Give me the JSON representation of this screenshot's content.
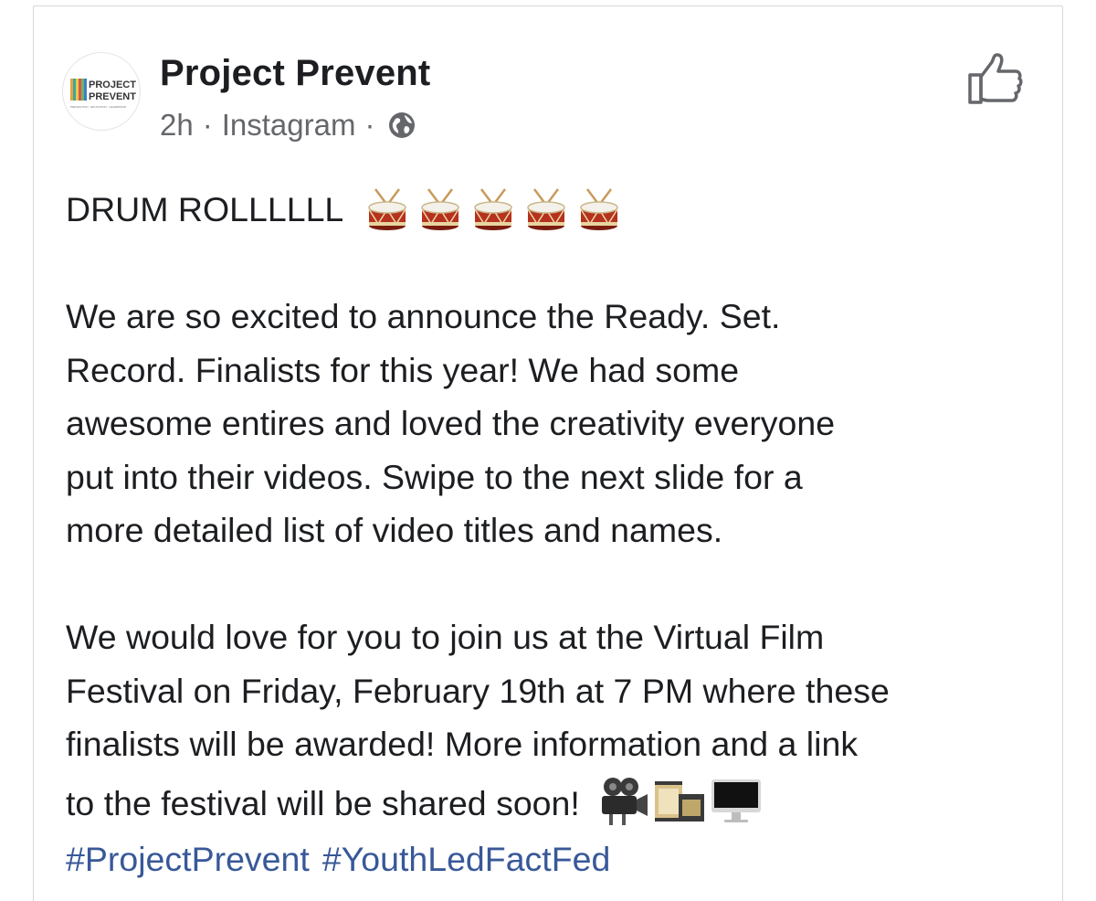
{
  "post": {
    "author": "Project Prevent",
    "avatar_text": {
      "line1": "PROJECT",
      "line2": "PREVENT",
      "tagline": "PREVENTION · EDUCATION · LEADERSHIP"
    },
    "time": "2h",
    "source": "Instagram",
    "separator": "·",
    "lines": {
      "l1": "DRUM ROLLLLLL",
      "p2_1": "We are so excited to announce the Ready. Set.",
      "p2_2": "Record. Finalists for this year! We had some",
      "p2_3": "awesome entires and loved the creativity everyone",
      "p2_4": "put into their videos. Swipe to the next slide for a",
      "p2_5": "more detailed list of video titles and names.",
      "p3_1": "We would love for you to join us at the Virtual Film",
      "p3_2": "Festival on Friday, February 19th at 7 PM where these",
      "p3_3": "finalists will be awarded! More information and a link",
      "p3_4": "to the festival will be shared soon!"
    },
    "hashtags": [
      "#ProjectPrevent",
      "#YouthLedFactFed"
    ],
    "icons": {
      "globe": "globe-icon",
      "like": "thumbs-up-icon",
      "drum_count": 5,
      "media": [
        "movie-camera-icon",
        "film-strip-icon",
        "desktop-computer-icon"
      ]
    },
    "colors": {
      "link": "#385898",
      "meta": "#65676b",
      "text": "#1c1e21"
    }
  }
}
